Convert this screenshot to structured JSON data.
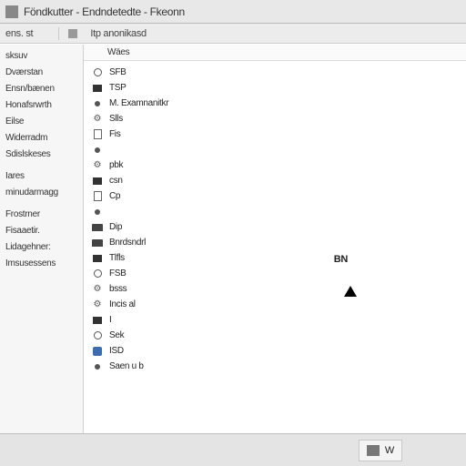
{
  "titlebar": {
    "title": "Föndkutter - Endndetedte - Fkeonn"
  },
  "toolbar": {
    "left_label": "ens. st",
    "tab_label": "Itp anonikasd"
  },
  "sidebar": {
    "items": [
      "sksuv",
      "Dværstan",
      "Ensn/bænen",
      "Honafsrwrth",
      "Eilse",
      "Widerradm",
      "Sdislskeses",
      "Iares",
      "minudarmagg",
      "Frostrner",
      "Fisaaetir.",
      "Lidagehner:",
      "Imsusessens"
    ]
  },
  "main": {
    "column_header": "Wäes",
    "items": [
      {
        "icon": "circle",
        "label": "SFB"
      },
      {
        "icon": "box",
        "label": "TSP"
      },
      {
        "icon": "dot",
        "label": "M. Examnanitkr"
      },
      {
        "icon": "gear",
        "label": "Slls"
      },
      {
        "icon": "page",
        "label": "Fis"
      },
      {
        "icon": "dot",
        "label": ""
      },
      {
        "icon": "gear",
        "label": "pbk"
      },
      {
        "icon": "box",
        "label": "csn"
      },
      {
        "icon": "page",
        "label": "Cp"
      },
      {
        "icon": "dot",
        "label": ""
      },
      {
        "icon": "folder",
        "label": "Dip"
      },
      {
        "icon": "folder",
        "label": "Bnrdsndrl"
      },
      {
        "icon": "box",
        "label": "Tlfls"
      },
      {
        "icon": "circle",
        "label": "FSB"
      },
      {
        "icon": "gear",
        "label": "bsss"
      },
      {
        "icon": "gear",
        "label": "Incis  al"
      },
      {
        "icon": "box",
        "label": "I"
      },
      {
        "icon": "circle",
        "label": "Sek"
      },
      {
        "icon": "blue",
        "label": "ISD"
      },
      {
        "icon": "dot",
        "label": "Saen u b"
      }
    ],
    "right_badge": "BN"
  },
  "statusbar": {
    "value": "W"
  }
}
